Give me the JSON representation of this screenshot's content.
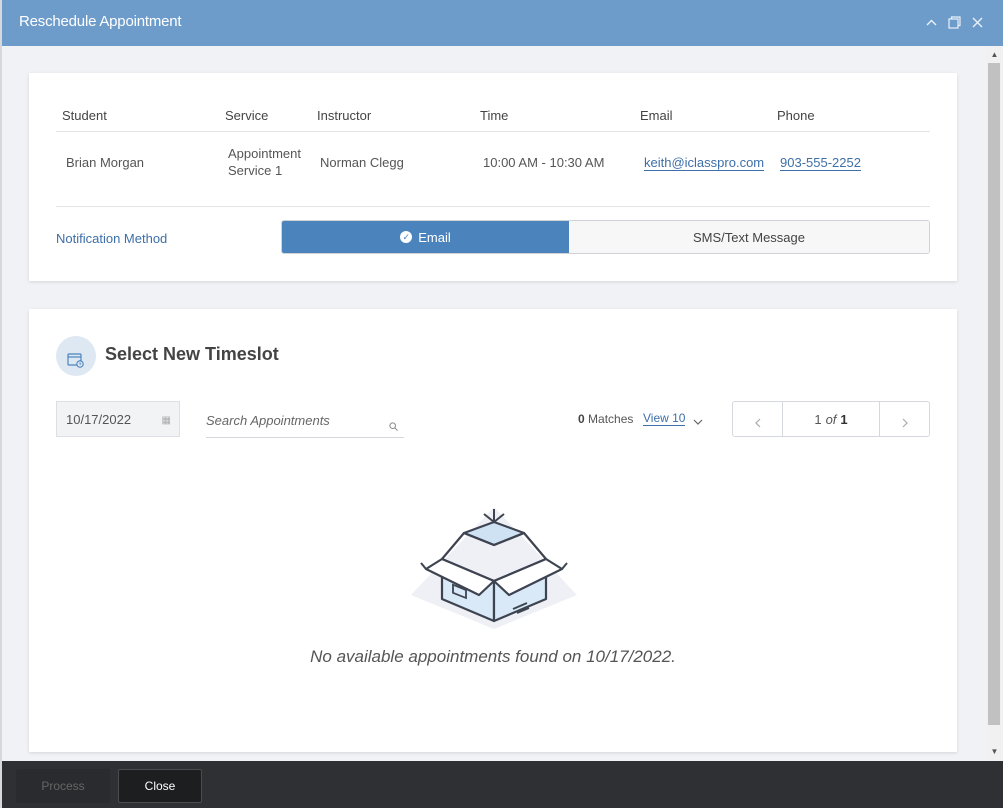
{
  "window": {
    "title": "Reschedule Appointment",
    "controls": [
      "chevron-up-icon",
      "restore-icon",
      "close-icon"
    ]
  },
  "appointment": {
    "headers": [
      "Student",
      "Service",
      "Instructor",
      "Time",
      "Email",
      "Phone"
    ],
    "student": "Brian Morgan",
    "service_line1": "Appointment",
    "service_line2": "Service 1",
    "instructor": "Norman Clegg",
    "time": "10:00 AM - 10:30 AM",
    "email": "keith@iclasspro.com",
    "phone": "903-555-2252"
  },
  "notification": {
    "label": "Notification Method",
    "options": [
      "Email",
      "SMS/Text Message"
    ],
    "selected": "Email"
  },
  "timeslot": {
    "title": "Select New Timeslot",
    "date_value": "10/17/2022",
    "search_placeholder": "Search Appointments",
    "matches_count": "0",
    "matches_label": "Matches",
    "view_label": "View 10",
    "page_current": "1",
    "page_of": "of",
    "page_total": "1",
    "empty_message": "No available appointments found on 10/17/2022."
  },
  "footer": {
    "process_label": "Process",
    "close_label": "Close"
  },
  "colors": {
    "titlebar": "#6d9ccb",
    "accent": "#4b84bc",
    "link": "#3d6fa8",
    "footer": "#2e3033"
  }
}
